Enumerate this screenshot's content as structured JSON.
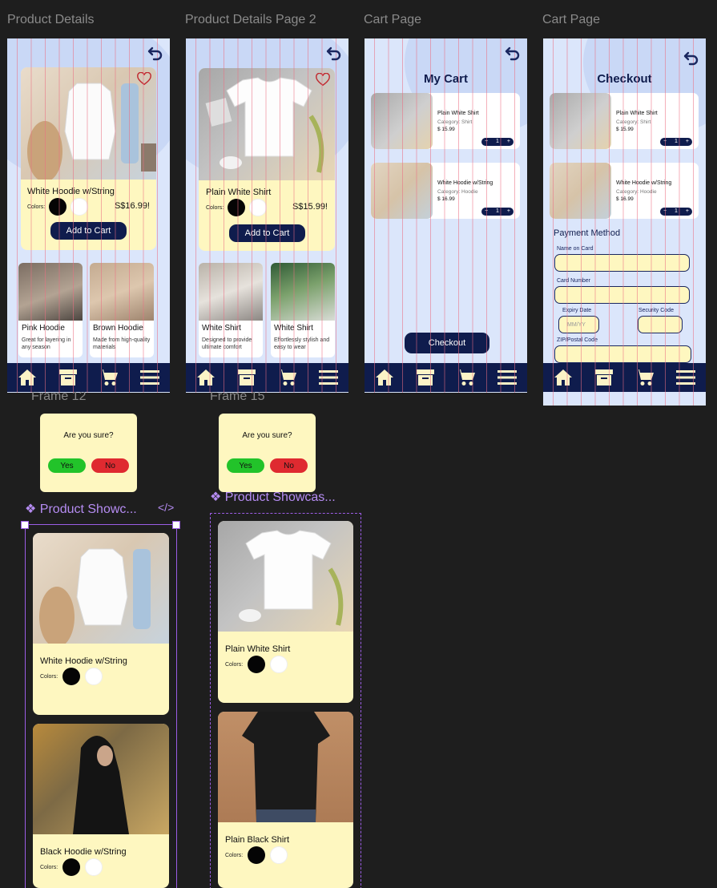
{
  "frames": {
    "product_details": {
      "label": "Product Details",
      "product": {
        "name": "White Hoodie w/String",
        "colors_label": "Colors:",
        "price": "S$16.99!"
      },
      "add_to_cart": "Add to Cart",
      "related": [
        {
          "title": "Pink Hoodie",
          "desc": "Great for layering in any season"
        },
        {
          "title": "Brown Hoodie",
          "desc": "Made from high-quality materials"
        }
      ]
    },
    "product_details_2": {
      "label": "Product Details Page 2",
      "product": {
        "name": "Plain White Shirt",
        "colors_label": "Colors:",
        "price": "S$15.99!"
      },
      "add_to_cart": "Add to Cart",
      "related": [
        {
          "title": "White Shirt",
          "desc": "Designed to provide ultimate comfort"
        },
        {
          "title": "White Shirt",
          "desc": "Effortlessly stylish and easy to wear"
        }
      ]
    },
    "cart": {
      "label": "Cart Page",
      "title": "My Cart",
      "items": [
        {
          "name": "Plain White Shirt",
          "category": "Category: Shirt",
          "price": "$ 15.99",
          "qty": "1"
        },
        {
          "name": "White Hoodie w/String",
          "category": "Category: Hoodie",
          "price": "$ 16.99",
          "qty": "1"
        }
      ],
      "checkout_button": "Checkout"
    },
    "checkout": {
      "label": "Cart Page",
      "title": "Checkout",
      "items": [
        {
          "name": "Plain White Shirt",
          "category": "Category: Shirt",
          "price": "$ 15.99",
          "qty": "1"
        },
        {
          "name": "White Hoodie w/String",
          "category": "Category: Hoodie",
          "price": "$ 16.99",
          "qty": "1"
        }
      ],
      "payment_heading": "Payment Method",
      "fields": {
        "name_on_card": "Name on Card",
        "card_number": "Card Number",
        "expiry_date": "Expiry Date",
        "expiry_placeholder": "MM/YY",
        "security_code": "Security Code",
        "zip": "ZIP/Postal Code"
      }
    }
  },
  "modals": [
    {
      "label": "Frame 12",
      "question": "Are you sure?",
      "yes": "Yes",
      "no": "No"
    },
    {
      "label": "Frame 15",
      "question": "Are you sure?",
      "yes": "Yes",
      "no": "No"
    }
  ],
  "components": [
    {
      "label": "❖ Product Showc...",
      "code_icon": "</>",
      "cards": [
        {
          "name": "White Hoodie w/String",
          "colors_label": "Colors:"
        },
        {
          "name": "Black Hoodie w/String",
          "colors_label": "Colors:"
        }
      ]
    },
    {
      "label": "❖ Product Showcas...",
      "cards": [
        {
          "name": "Plain White Shirt",
          "colors_label": "Colors:"
        },
        {
          "name": "Plain Black Shirt",
          "colors_label": "Colors:"
        }
      ]
    }
  ],
  "icons": [
    "undo-icon",
    "heart-icon",
    "home-icon",
    "archive-icon",
    "cart-icon",
    "menu-icon",
    "code-icon",
    "minus-icon",
    "plus-icon"
  ],
  "colors": {
    "navy": "#0f1c4d",
    "cream": "#fef7c0",
    "frame_bg": "#dbe6fb",
    "canvas": "#1e1e1e",
    "yes": "#22c32a",
    "no": "#df2a30",
    "component": "#9b5de5"
  }
}
